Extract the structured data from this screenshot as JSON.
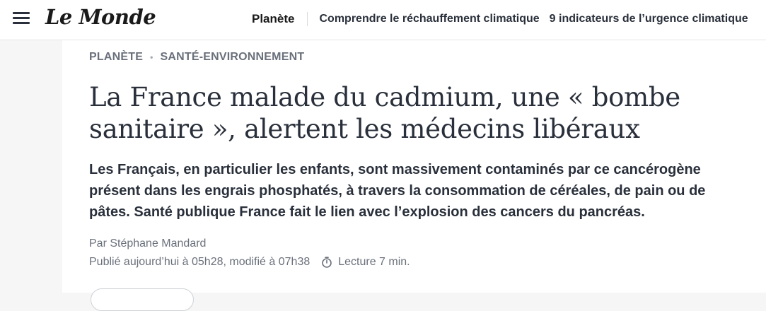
{
  "header": {
    "logo": "Le Monde",
    "primary_link": "Planète",
    "links": [
      "Comprendre le réchauffement climatique",
      "9 indicateurs de l’urgence climatique"
    ]
  },
  "article": {
    "breadcrumb": [
      "PLANÈTE",
      "SANTÉ-ENVIRONNEMENT"
    ],
    "title": "La France malade du cadmium, une « bombe sanitaire », alertent les médecins libéraux",
    "standfirst": "Les Français, en particulier les enfants, sont massivement contaminés par ce cancérogène présent dans les engrais phosphatés, à travers la consommation de céréales, de pain ou de pâtes. Santé publique France fait le lien avec l’explosion des cancers du pancréas.",
    "author": "Par Stéphane Mandard",
    "published": "Publié aujourd’hui à 05h28, modifié à 07h38",
    "reading_time": "Lecture 7 min."
  },
  "icons": {
    "menu": "hamburger-menu-icon",
    "clock": "timer-icon"
  },
  "colors": {
    "text": "#2a303b",
    "muted": "#6a707b",
    "page_bg": "#f6f6f6"
  }
}
